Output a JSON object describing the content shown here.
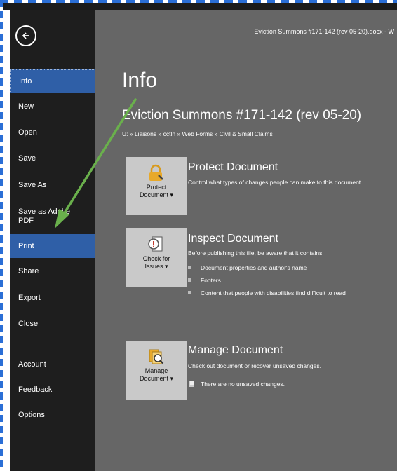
{
  "document": {
    "title": "Eviction Summons #171-142 (rev 05-20).docx - W",
    "name": "Eviction Summons #171-142 (rev 05-20)",
    "path": "U: » Liaisons » cctln » Web Forms » Civil & Small Claims"
  },
  "page": {
    "heading": "Info"
  },
  "nav": {
    "items": [
      {
        "label": "Info"
      },
      {
        "label": "New"
      },
      {
        "label": "Open"
      },
      {
        "label": "Save"
      },
      {
        "label": "Save As"
      },
      {
        "label": "Save as Adobe PDF"
      },
      {
        "label": "Print"
      },
      {
        "label": "Share"
      },
      {
        "label": "Export"
      },
      {
        "label": "Close"
      },
      {
        "label": "Account"
      },
      {
        "label": "Feedback"
      },
      {
        "label": "Options"
      }
    ]
  },
  "sections": {
    "protect": {
      "button_line1": "Protect",
      "button_line2": "Document ▾",
      "title": "Protect Document",
      "description": "Control what types of changes people can make to this document."
    },
    "inspect": {
      "button_line1": "Check for",
      "button_line2": "Issues ▾",
      "title": "Inspect Document",
      "description": "Before publishing this file, be aware that it contains:",
      "bullets": [
        "Document properties and author's name",
        "Footers",
        "Content that people with disabilities find difficult to read"
      ]
    },
    "manage": {
      "button_line1": "Manage",
      "button_line2": "Document ▾",
      "title": "Manage Document",
      "description": "Check out document or recover unsaved changes.",
      "note": "There are no unsaved changes."
    }
  },
  "colors": {
    "sidebar": "#1e1e1e",
    "active": "#2f5fa7",
    "main": "#666666",
    "tile": "#c9c9c9",
    "annotation_arrow": "#6ab04c"
  }
}
